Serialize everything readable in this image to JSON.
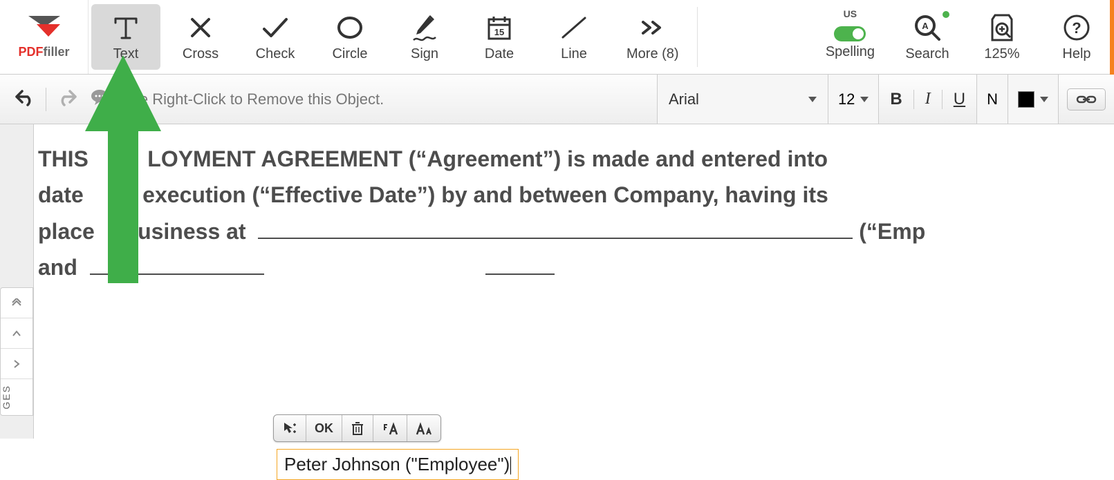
{
  "logo": {
    "pdf": "PDF",
    "filler": "filler"
  },
  "toolbar": {
    "text": "Text",
    "cross": "Cross",
    "check": "Check",
    "circle": "Circle",
    "sign": "Sign",
    "date": "Date",
    "line": "Line",
    "more": "More (8)",
    "spelling": "Spelling",
    "spelling_lang": "US",
    "search": "Search",
    "zoom": "125%",
    "help": "Help"
  },
  "secondary": {
    "hint": "Use Right-Click to Remove this Object.",
    "font": "Arial",
    "size": "12",
    "bold": "B",
    "italic": "I",
    "underline": "U",
    "normal": "N"
  },
  "document": {
    "line1a": "THIS",
    "line1b": "LOYMENT AGREEMENT (“Agreement”) is made and entered into",
    "line2a": "date",
    "line2b": "execution (“Effective Date”) by and between Company, having its",
    "line3a": "place",
    "line3b": "business at",
    "line3c": "(“Emp",
    "line4a": "and"
  },
  "float_toolbar": {
    "ok": "OK"
  },
  "field": {
    "value": "Peter Johnson (\"Employee\")"
  },
  "pages": {
    "label": "GES"
  }
}
